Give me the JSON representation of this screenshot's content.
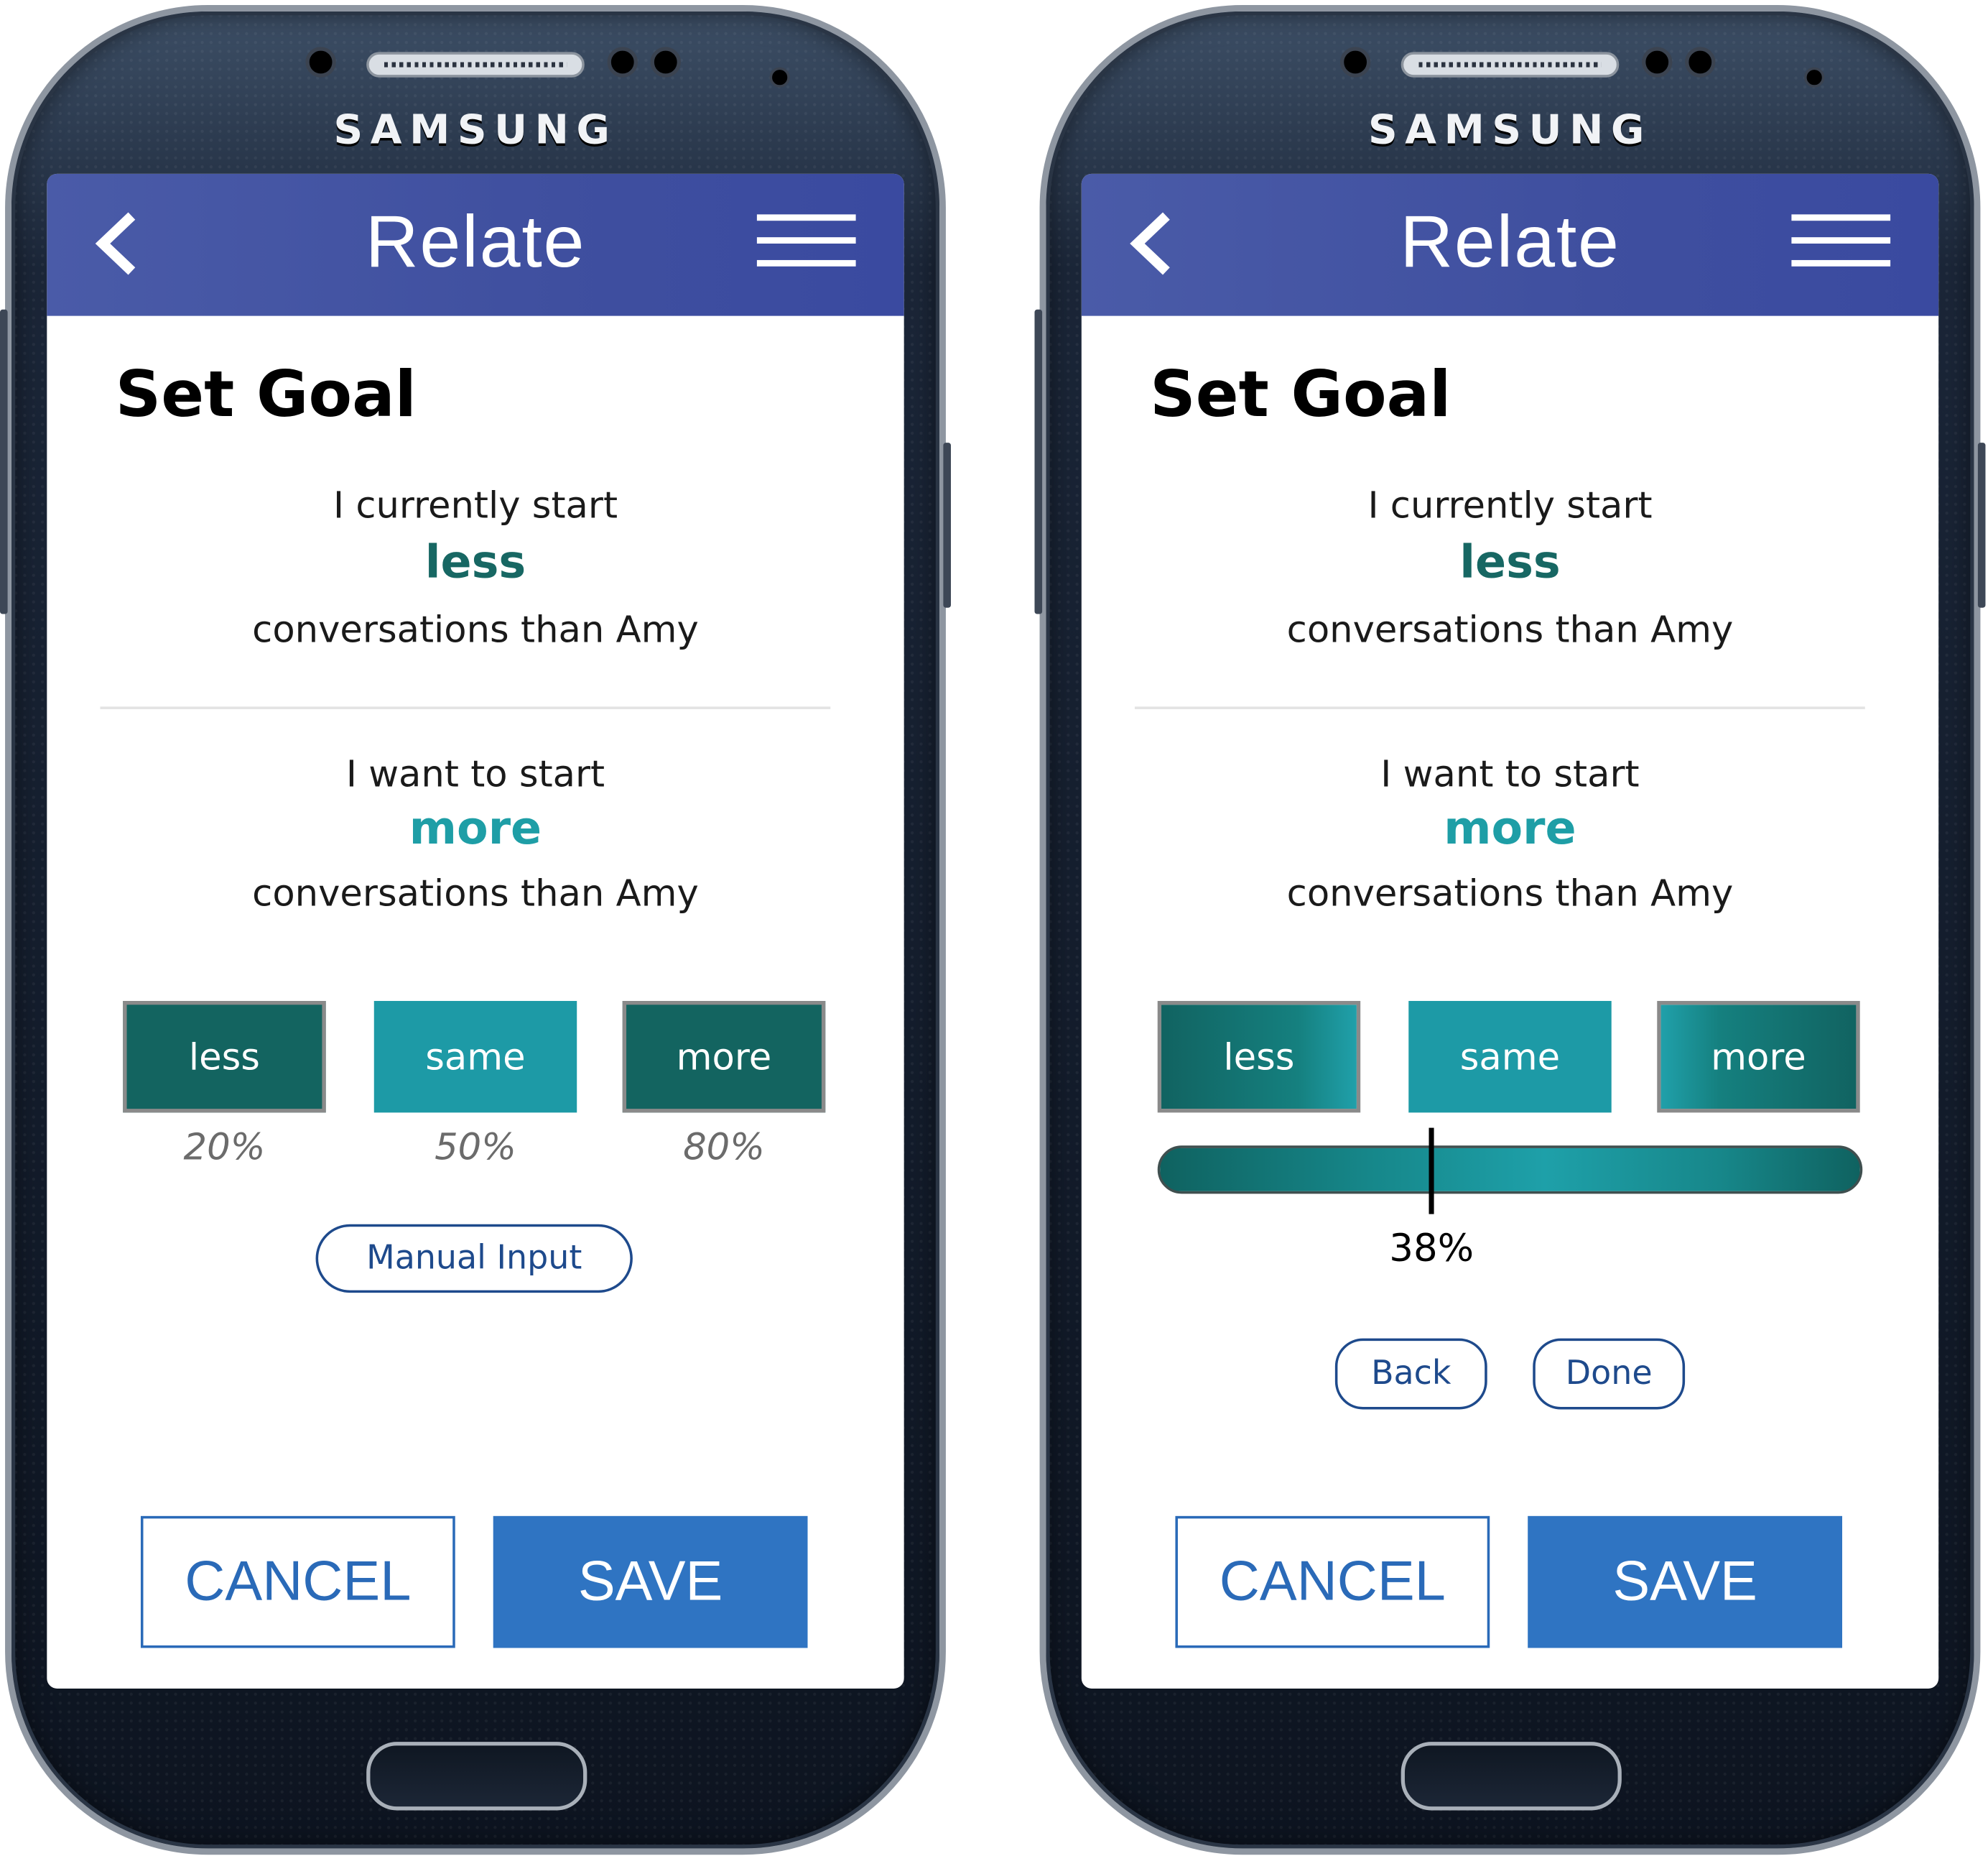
{
  "device": {
    "brand": "SAMSUNG"
  },
  "colors": {
    "app_bar": "#4050a0",
    "teal_dark": "#136460",
    "teal_light": "#1d9aa6",
    "primary_blue": "#2f74c2",
    "outline_blue": "#1e4a8c"
  },
  "screens": [
    {
      "app_bar": {
        "title": "Relate",
        "back_icon": "chevron-left-icon",
        "menu_icon": "hamburger-menu-icon"
      },
      "page_title": "Set Goal",
      "current": {
        "prefix": "I currently start",
        "value": "less",
        "suffix": "conversations than Amy"
      },
      "target": {
        "prefix": "I want to start",
        "value": "more",
        "suffix": "conversations than Amy"
      },
      "options": [
        {
          "label": "less",
          "percent": "20%"
        },
        {
          "label": "same",
          "percent": "50%"
        },
        {
          "label": "more",
          "percent": "80%"
        }
      ],
      "manual_input_label": "Manual Input",
      "cancel_label": "CANCEL",
      "save_label": "SAVE"
    },
    {
      "app_bar": {
        "title": "Relate",
        "back_icon": "chevron-left-icon",
        "menu_icon": "hamburger-menu-icon"
      },
      "page_title": "Set Goal",
      "current": {
        "prefix": "I currently start",
        "value": "less",
        "suffix": "conversations than Amy"
      },
      "target": {
        "prefix": "I want to start",
        "value": "more",
        "suffix": "conversations than Amy"
      },
      "options": [
        {
          "label": "less"
        },
        {
          "label": "same"
        },
        {
          "label": "more"
        }
      ],
      "slider": {
        "value_label": "38%",
        "value": 38
      },
      "back_label": "Back",
      "done_label": "Done",
      "cancel_label": "CANCEL",
      "save_label": "SAVE"
    }
  ]
}
